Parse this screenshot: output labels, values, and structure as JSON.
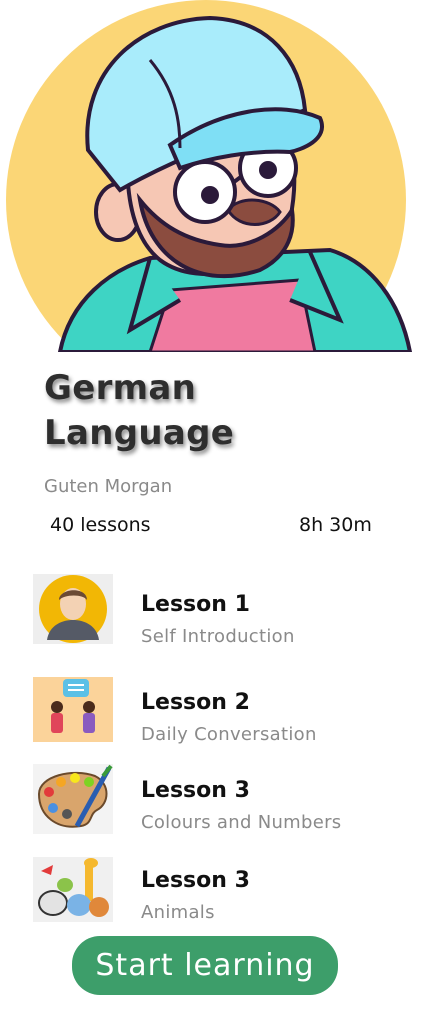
{
  "course": {
    "title_line1": "German",
    "title_line2": "Language",
    "subtitle": "Guten Morgan",
    "lessons_count": "40 lessons",
    "duration": "8h 30m"
  },
  "lessons": [
    {
      "title": "Lesson 1",
      "subtitle": "Self Introduction",
      "thumb_icon": "avatar-icon"
    },
    {
      "title": "Lesson 2",
      "subtitle": "Daily Conversation",
      "thumb_icon": "conversation-icon"
    },
    {
      "title": "Lesson 3",
      "subtitle": "Colours and Numbers",
      "thumb_icon": "paint-palette-icon"
    },
    {
      "title": "Lesson 3",
      "subtitle": "Animals",
      "thumb_icon": "animals-icon"
    }
  ],
  "start_button": {
    "label": "Start learning"
  },
  "colors": {
    "hero_circle": "#fbd676",
    "cap": "#a9ecfb",
    "jacket": "#3ed4c4",
    "start_button": "#3d9e6a"
  }
}
